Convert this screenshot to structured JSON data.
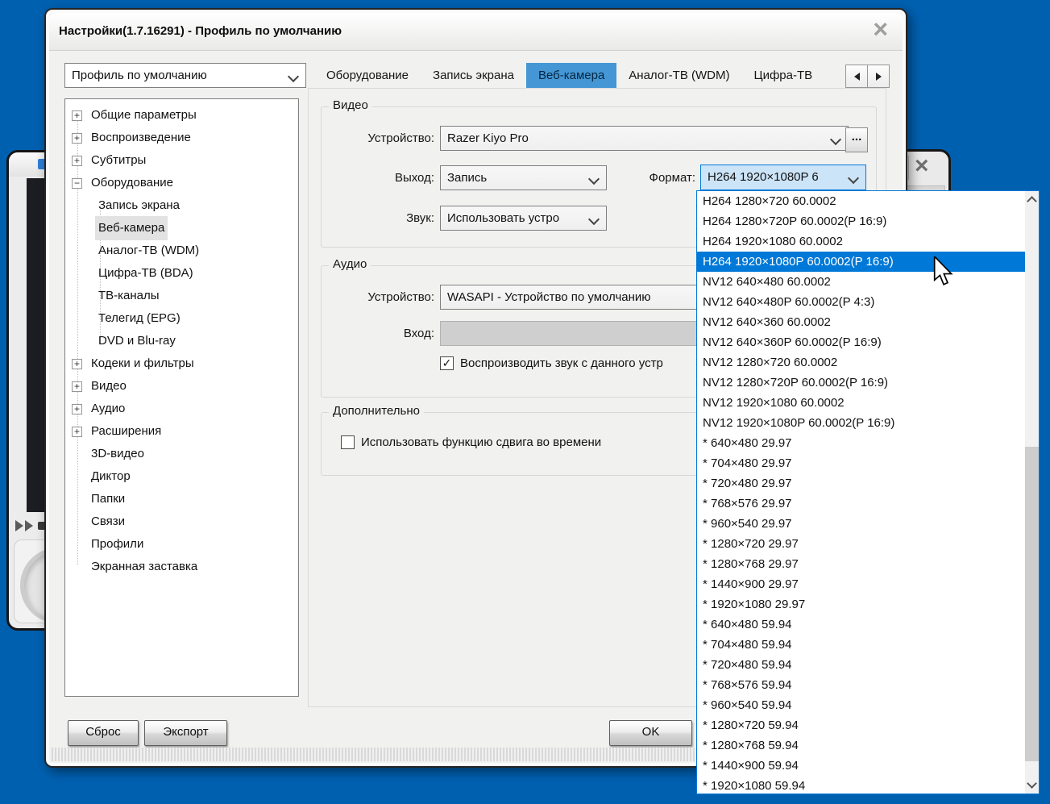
{
  "colors": {
    "desktop": "#0060b0",
    "accent": "#0078d7",
    "tab_active": "#4496d4"
  },
  "background_window": {
    "close_glyph": "×"
  },
  "dialog": {
    "title": "Настройки(1.7.16291) - Профиль по умолчанию",
    "close_glyph": "×",
    "profile_combo": {
      "value": "Профиль по умолчанию"
    },
    "tabs": [
      {
        "label": "Оборудование",
        "active": false
      },
      {
        "label": "Запись экрана",
        "active": false
      },
      {
        "label": "Веб-камера",
        "active": true
      },
      {
        "label": "Аналог-ТВ (WDM)",
        "active": false
      },
      {
        "label": "Цифра-ТВ",
        "active": false
      }
    ],
    "tree": {
      "items": [
        {
          "label": "Общие параметры",
          "expand": "+",
          "level": 0,
          "selected": false
        },
        {
          "label": "Воспроизведение",
          "expand": "+",
          "level": 0,
          "selected": false
        },
        {
          "label": "Субтитры",
          "expand": "+",
          "level": 0,
          "selected": false
        },
        {
          "label": "Оборудование",
          "expand": "−",
          "level": 0,
          "selected": false
        },
        {
          "label": "Запись экрана",
          "expand": "",
          "level": 1,
          "selected": false
        },
        {
          "label": "Веб-камера",
          "expand": "",
          "level": 1,
          "selected": true
        },
        {
          "label": "Аналог-ТВ (WDM)",
          "expand": "",
          "level": 1,
          "selected": false
        },
        {
          "label": "Цифра-ТВ (BDA)",
          "expand": "",
          "level": 1,
          "selected": false
        },
        {
          "label": "ТВ-каналы",
          "expand": "",
          "level": 1,
          "selected": false
        },
        {
          "label": "Телегид (EPG)",
          "expand": "",
          "level": 1,
          "selected": false
        },
        {
          "label": "DVD и Blu-ray",
          "expand": "",
          "level": 1,
          "selected": false
        },
        {
          "label": "Кодеки и фильтры",
          "expand": "+",
          "level": 0,
          "selected": false
        },
        {
          "label": "Видео",
          "expand": "+",
          "level": 0,
          "selected": false
        },
        {
          "label": "Аудио",
          "expand": "+",
          "level": 0,
          "selected": false
        },
        {
          "label": "Расширения",
          "expand": "+",
          "level": 0,
          "selected": false
        },
        {
          "label": "3D-видео",
          "expand": "",
          "level": 0,
          "selected": false
        },
        {
          "label": "Диктор",
          "expand": "",
          "level": 0,
          "selected": false
        },
        {
          "label": "Папки",
          "expand": "",
          "level": 0,
          "selected": false
        },
        {
          "label": "Связи",
          "expand": "",
          "level": 0,
          "selected": false
        },
        {
          "label": "Профили",
          "expand": "",
          "level": 0,
          "selected": false
        },
        {
          "label": "Экранная заставка",
          "expand": "",
          "level": 0,
          "selected": false
        }
      ]
    },
    "video_group": {
      "title": "Видео",
      "device_label": "Устройство:",
      "device_value": "Razer Kiyo Pro",
      "more_button": "...",
      "output_label": "Выход:",
      "output_value": "Запись",
      "format_label": "Формат:",
      "format_value": "H264 1920×1080P 6",
      "sound_label": "Звук:",
      "sound_value": "Использовать устро"
    },
    "audio_group": {
      "title": "Аудио",
      "device_label": "Устройство:",
      "device_value": "WASAPI - Устройство по умолчанию",
      "input_label": "Вход:",
      "play_checkbox_label": "Воспроизводить звук с данного устр"
    },
    "extra_group": {
      "title": "Дополнительно",
      "timeshift_checkbox_label": "Использовать функцию сдвига во времени"
    },
    "buttons": {
      "reset": "Сброс",
      "export": "Экспорт",
      "ok": "OK"
    }
  },
  "format_dropdown": {
    "selected_index": 3,
    "items": [
      "H264 1280×720 60.0002",
      "H264 1280×720P 60.0002(P 16:9)",
      "H264 1920×1080 60.0002",
      "H264 1920×1080P 60.0002(P 16:9)",
      "NV12 640×480 60.0002",
      "NV12 640×480P 60.0002(P 4:3)",
      "NV12 640×360 60.0002",
      "NV12 640×360P 60.0002(P 16:9)",
      "NV12 1280×720 60.0002",
      "NV12 1280×720P 60.0002(P 16:9)",
      "NV12 1920×1080 60.0002",
      "NV12 1920×1080P 60.0002(P 16:9)",
      "* 640×480 29.97",
      "* 704×480 29.97",
      "* 720×480 29.97",
      "* 768×576 29.97",
      "* 960×540 29.97",
      "* 1280×720 29.97",
      "* 1280×768 29.97",
      "* 1440×900 29.97",
      "* 1920×1080 29.97",
      "* 640×480 59.94",
      "* 704×480 59.94",
      "* 720×480 59.94",
      "* 768×576 59.94",
      "* 960×540 59.94",
      "* 1280×720 59.94",
      "* 1280×768 59.94",
      "* 1440×900 59.94",
      "* 1920×1080 59.94"
    ]
  }
}
